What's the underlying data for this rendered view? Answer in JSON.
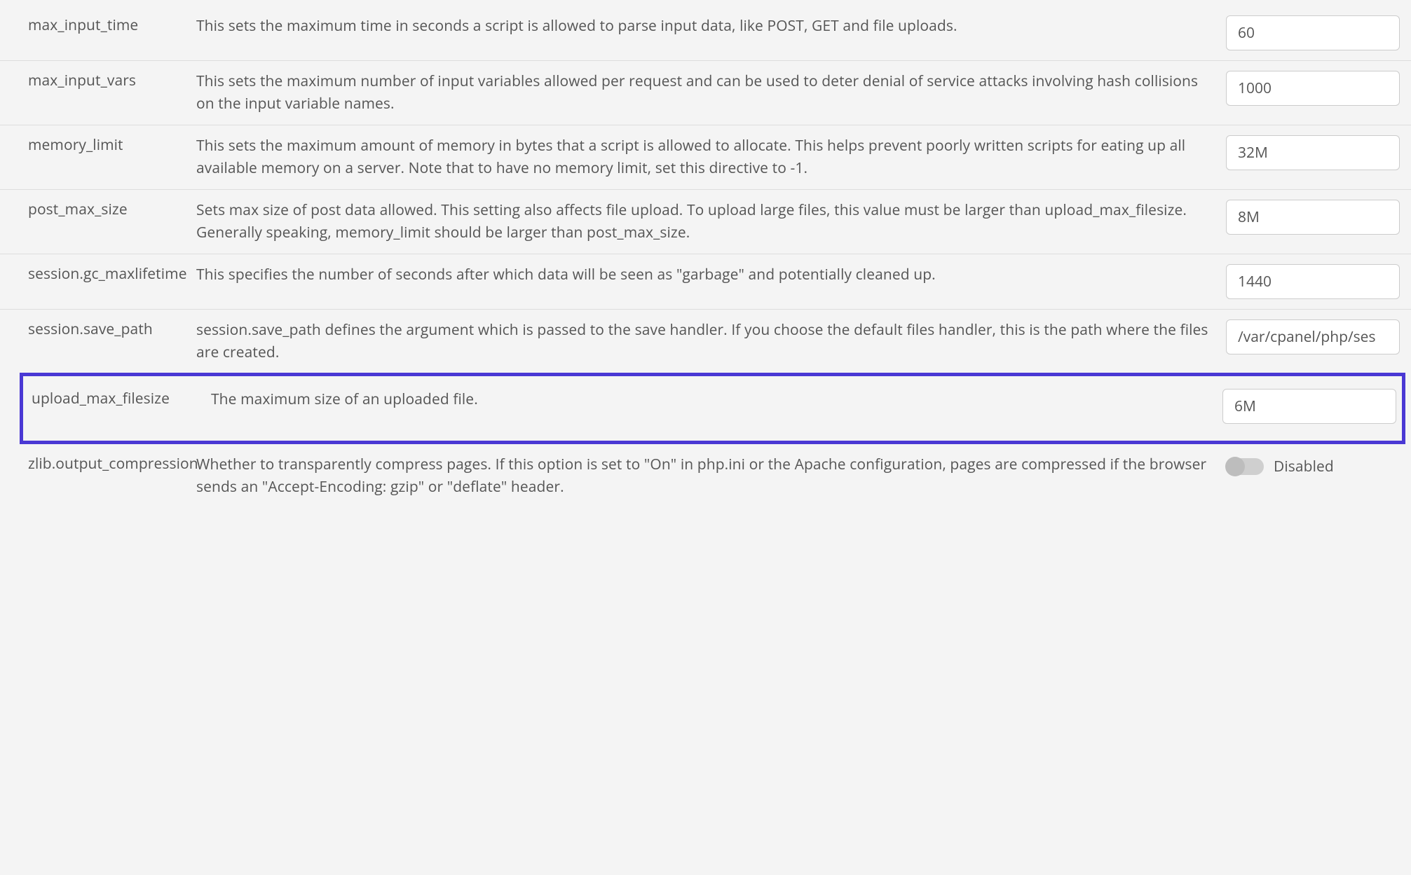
{
  "settings": [
    {
      "name": "max_input_time",
      "desc": "This sets the maximum time in seconds a script is allowed to parse input data, like POST, GET and file uploads.",
      "type": "text",
      "value": "60"
    },
    {
      "name": "max_input_vars",
      "desc": "This sets the maximum number of input variables allowed per request and can be used to deter denial of service attacks involving hash collisions on the input variable names.",
      "type": "text",
      "value": "1000"
    },
    {
      "name": "memory_limit",
      "desc": "This sets the maximum amount of memory in bytes that a script is allowed to allocate. This helps prevent poorly written scripts for eating up all available memory on a server. Note that to have no memory limit, set this directive to -1.",
      "type": "text",
      "value": "32M"
    },
    {
      "name": "post_max_size",
      "desc": "Sets max size of post data allowed. This setting also affects file upload. To upload large files, this value must be larger than upload_max_filesize. Generally speaking, memory_limit should be larger than post_max_size.",
      "type": "text",
      "value": "8M"
    },
    {
      "name": "session.gc_maxlifetime",
      "desc": "This specifies the number of seconds after which data will be seen as \"garbage\" and potentially cleaned up.",
      "type": "text",
      "value": "1440"
    },
    {
      "name": "session.save_path",
      "desc": "session.save_path defines the argument which is passed to the save handler. If you choose the default files handler, this is the path where the files are created.",
      "type": "text",
      "value": "/var/cpanel/php/ses"
    },
    {
      "name": "upload_max_filesize",
      "desc": "The maximum size of an uploaded file.",
      "type": "text",
      "value": "6M",
      "highlight": true
    },
    {
      "name": "zlib.output_compression",
      "desc": "Whether to transparently compress pages. If this option is set to \"On\" in php.ini or the Apache configuration, pages are compressed if the browser sends an \"Accept-Encoding: gzip\" or \"deflate\" header.",
      "type": "toggle",
      "enabled": false,
      "toggleLabel": "Disabled",
      "cutoff": true
    }
  ]
}
